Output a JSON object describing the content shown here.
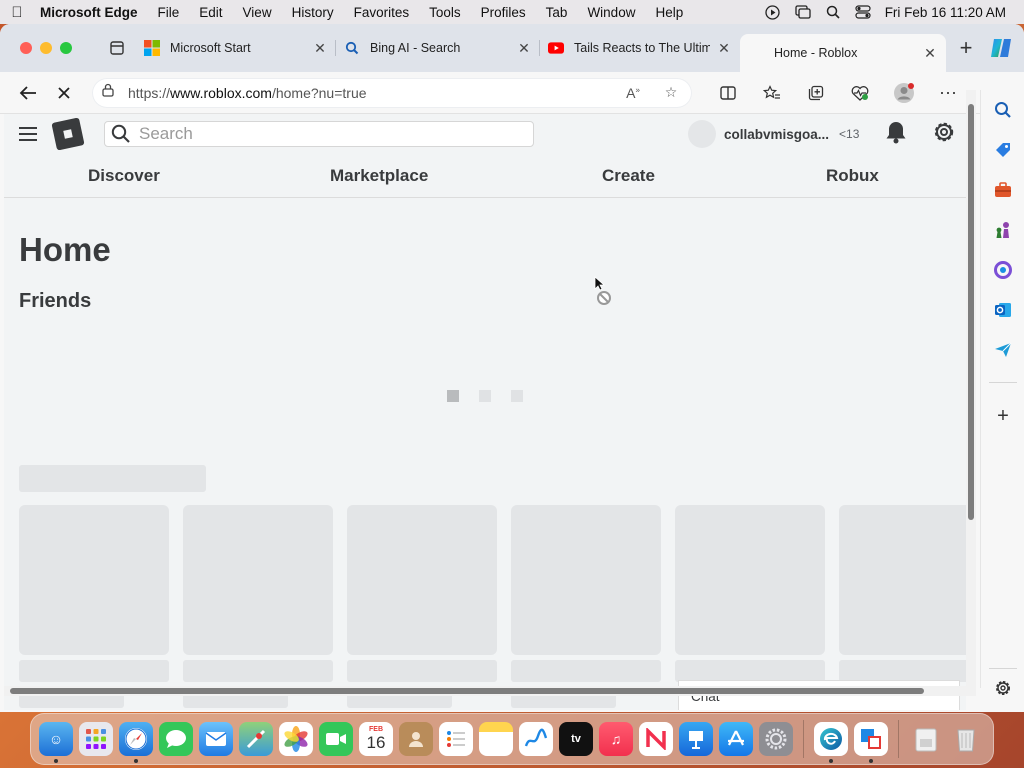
{
  "menubar": {
    "app_name": "Microsoft Edge",
    "items": [
      "File",
      "Edit",
      "View",
      "History",
      "Favorites",
      "Tools",
      "Profiles",
      "Tab",
      "Window",
      "Help"
    ],
    "datetime": "Fri Feb 16  11:20 AM"
  },
  "tabs": [
    {
      "title": "Microsoft Start",
      "icon": "microsoft-logo-icon"
    },
    {
      "title": "Bing AI - Search",
      "icon": "search-icon"
    },
    {
      "title": "Tails Reacts to The Ultim",
      "icon": "youtube-icon"
    },
    {
      "title": "Home - Roblox",
      "icon": "none",
      "active": true
    }
  ],
  "toolbar": {
    "url_prefix": "https://",
    "url_host": "www.roblox.com",
    "url_path": "/home?nu=true"
  },
  "roblox": {
    "search_placeholder": "Search",
    "username": "collabvmisgoa...",
    "age_badge": "<13",
    "nav": [
      "Discover",
      "Marketplace",
      "Create",
      "Robux"
    ],
    "page_title": "Home",
    "friends_heading": "Friends",
    "chat_label": "Chat"
  },
  "dock": {
    "calendar_month": "FEB",
    "calendar_day": "16"
  },
  "colors": {
    "accent_edge": "#0c59a4",
    "roblox_text": "#393b3d",
    "skeleton": "#e3e5e7"
  }
}
